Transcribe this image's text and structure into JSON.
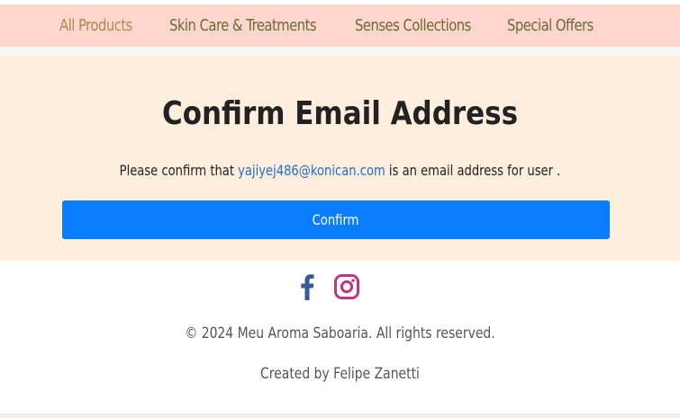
{
  "nav": {
    "items": [
      {
        "label": "All Products"
      },
      {
        "label": "Skin Care & Treatments"
      },
      {
        "label": "Senses Collections"
      },
      {
        "label": "Special Offers"
      }
    ]
  },
  "main": {
    "title": "Confirm Email Address",
    "text_before": "Please confirm that ",
    "email": "yajiyej486@konican.com",
    "text_after": " is an email address for user .",
    "button_label": "Confirm"
  },
  "footer": {
    "social_icons": [
      "facebook-icon",
      "instagram-icon"
    ],
    "copyright": "© 2024 Meu Aroma Saboaria. All rights reserved.",
    "credit": "Created by Felipe Zanetti"
  },
  "colors": {
    "nav_background": "#ffd6cc",
    "main_background": "#feeedd",
    "button": "#0a7cff",
    "link": "#1f6fd0",
    "facebook": "#3b5998",
    "instagram": "#c13584"
  }
}
